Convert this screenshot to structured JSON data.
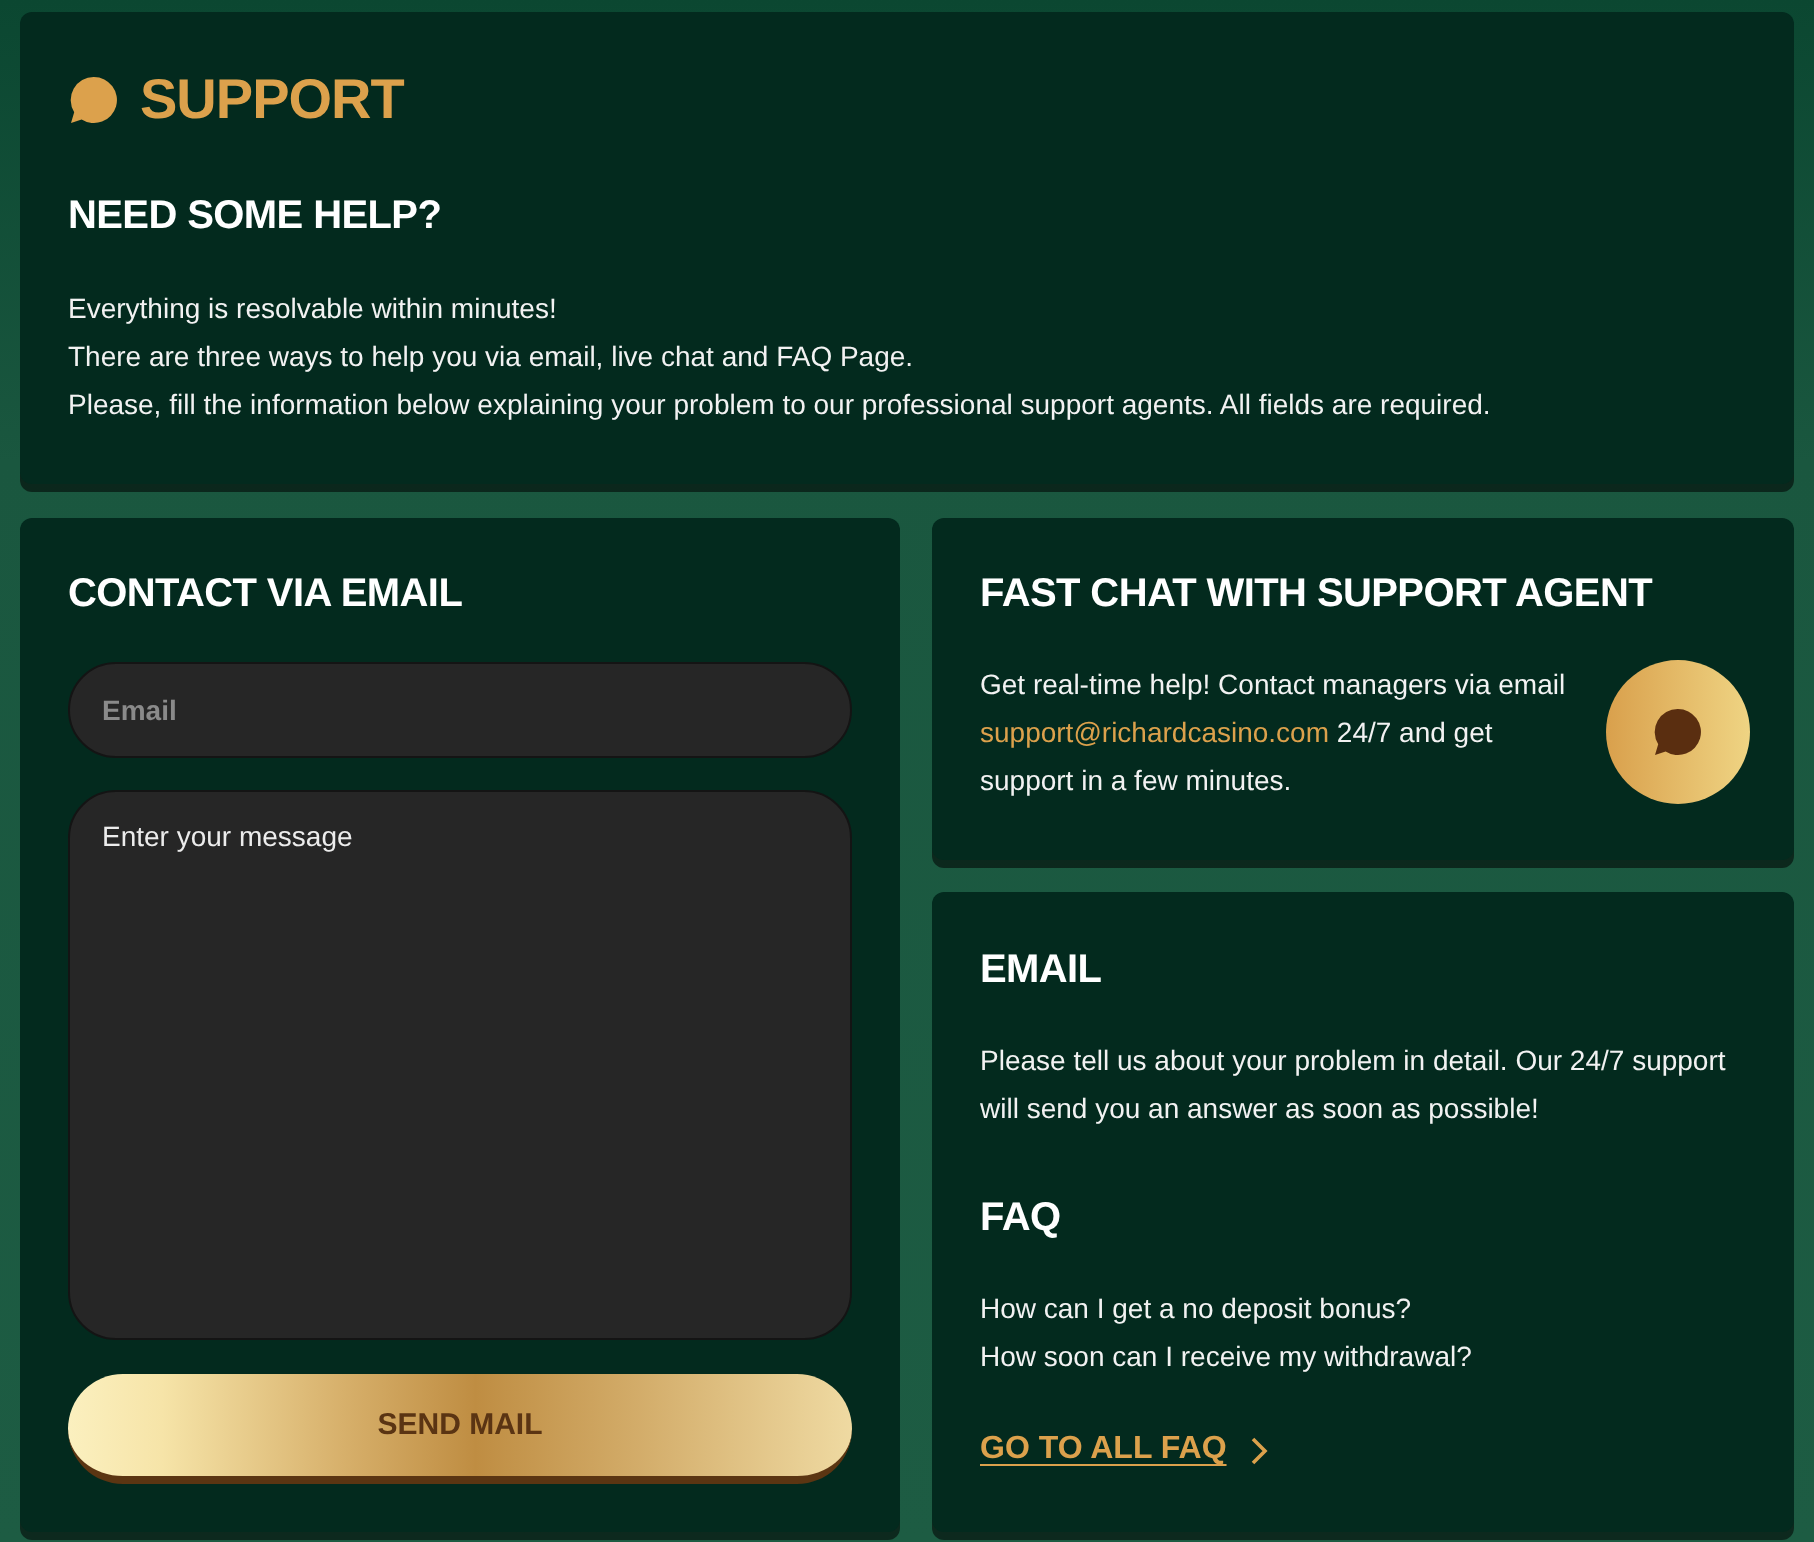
{
  "header": {
    "title": "SUPPORT",
    "subtitle": "NEED SOME HELP?",
    "lines": [
      "Everything is resolvable within minutes!",
      "There are three ways to help you via email, live chat and FAQ Page.",
      "Please, fill the information below explaining your problem to our professional support agents. All fields are required."
    ]
  },
  "contact_form": {
    "title": "CONTACT VIA EMAIL",
    "email_field": {
      "placeholder": "Email"
    },
    "message_field": {
      "placeholder": "Enter your message"
    },
    "submit_button": "SEND MAIL"
  },
  "fast_chat": {
    "title": "FAST CHAT WITH SUPPORT AGENT",
    "text_before": "Get real-time help! Contact managers via email",
    "link": "support@richardcasino.com",
    "text_after": "24/7 and get support in a few minutes."
  },
  "email_info": {
    "title": "EMAIL",
    "text": "Please tell us about your problem in detail. Our 24/7 support will send you an answer as soon as possible!"
  },
  "faq": {
    "title": "FAQ",
    "questions": [
      "How can I get a no deposit bonus?",
      "How soon can I receive my withdrawal?"
    ],
    "link": "GO TO ALL FAQ"
  }
}
